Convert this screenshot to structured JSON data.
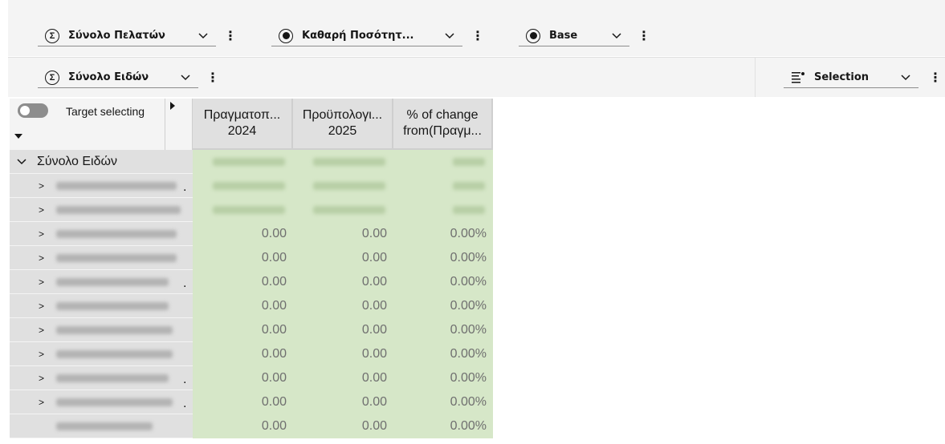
{
  "toolbar_row1": {
    "dropdowns": [
      {
        "label": "Σύνολο Πελατών",
        "icon": "sigma-icon"
      },
      {
        "label": "Καθαρή Ποσότητ...",
        "icon": "target-icon"
      },
      {
        "label": "Base",
        "icon": "target-icon"
      }
    ]
  },
  "toolbar_row2": {
    "rows_dropdown": {
      "label": "Σύνολο Ειδών",
      "icon": "sigma-icon"
    },
    "selection_dropdown": {
      "label": "Selection",
      "icon": "selection-list-icon"
    }
  },
  "crosstab": {
    "toggle_label": "Target selecting",
    "columns": [
      {
        "line1": "Πραγματοπ...",
        "line2": "2024"
      },
      {
        "line1": "Προϋπολογι...",
        "line2": "2025"
      },
      {
        "line1": "% of change",
        "line2": "from(Πραγμ..."
      }
    ],
    "total_row_label": "Σύνολο Ειδών",
    "rows": [
      {
        "values": [
          "0.00",
          "0.00",
          "0.00%"
        ]
      },
      {
        "values": [
          "0.00",
          "0.00",
          "0.00%"
        ]
      },
      {
        "values": [
          "0.00",
          "0.00",
          "0.00%"
        ]
      },
      {
        "values": [
          "0.00",
          "0.00",
          "0.00%"
        ]
      },
      {
        "values": [
          "0.00",
          "0.00",
          "0.00%"
        ]
      },
      {
        "values": [
          "0.00",
          "0.00",
          "0.00%"
        ]
      },
      {
        "values": [
          "0.00",
          "0.00",
          "0.00%"
        ]
      },
      {
        "values": [
          "0.00",
          "0.00",
          "0.00%"
        ]
      },
      {
        "values": [
          "0.00",
          "0.00",
          "0.00%"
        ]
      }
    ]
  },
  "colors": {
    "data_cell_bg": "#d6e7c8",
    "header_bg": "#e0e0e0",
    "toolbar_bg": "#f4f4f4"
  }
}
